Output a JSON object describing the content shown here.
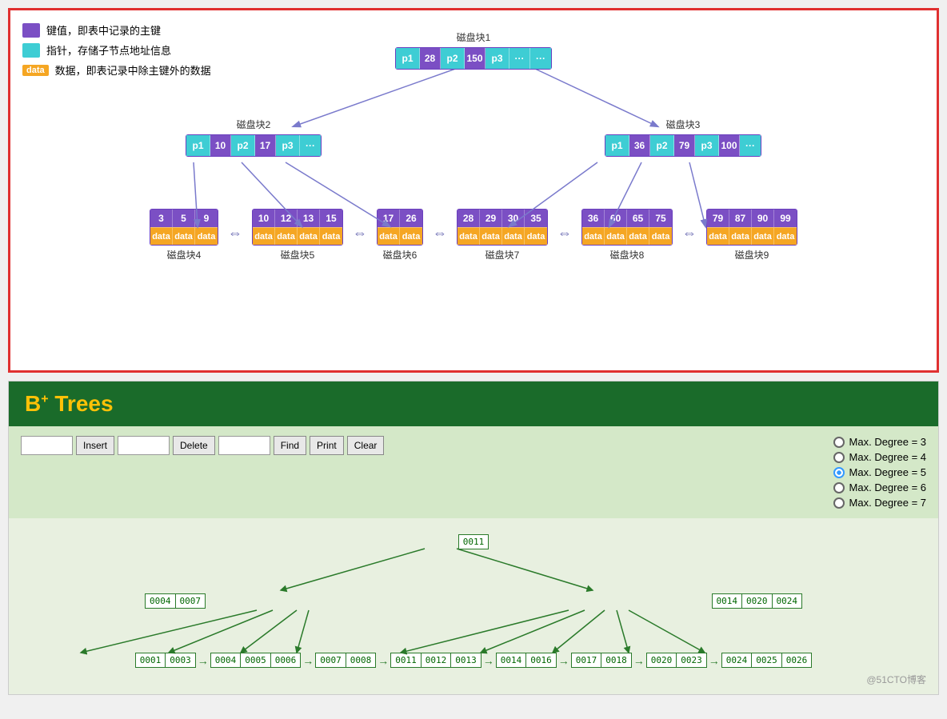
{
  "top": {
    "legend": [
      {
        "color": "purple",
        "text": "键值，即表中记录的主键"
      },
      {
        "color": "teal",
        "text": "指针，存储子节点地址信息"
      },
      {
        "color": "orange",
        "text": "数据，即表记录中除主键外的数据",
        "label": "data"
      }
    ],
    "disk1": {
      "label": "磁盘块1",
      "cells": [
        "p1",
        "28",
        "p2",
        "150",
        "p3",
        "...",
        "..."
      ]
    },
    "disk2": {
      "label": "磁盘块2",
      "cells": [
        "p1",
        "10",
        "p2",
        "17",
        "p3",
        "..."
      ]
    },
    "disk3": {
      "label": "磁盘块3",
      "cells": [
        "p1",
        "36",
        "p2",
        "79",
        "p3",
        "100",
        "..."
      ]
    },
    "leaves": [
      {
        "label": "磁盘块4",
        "keys": [
          "3",
          "5",
          "9"
        ]
      },
      {
        "label": "磁盘块5",
        "keys": [
          "10",
          "12",
          "13",
          "15"
        ]
      },
      {
        "label": "磁盘块6",
        "keys": [
          "17",
          "26"
        ]
      },
      {
        "label": "磁盘块7",
        "keys": [
          "28",
          "29",
          "30",
          "35"
        ]
      },
      {
        "label": "磁盘块8",
        "keys": [
          "36",
          "60",
          "65",
          "75"
        ]
      },
      {
        "label": "磁盘块9",
        "keys": [
          "79",
          "87",
          "90",
          "99"
        ]
      }
    ]
  },
  "bottom": {
    "title": "B",
    "title_sup": "+",
    "title_rest": " Trees",
    "controls": {
      "insert_label": "Insert",
      "delete_label": "Delete",
      "find_label": "Find",
      "print_label": "Print",
      "clear_label": "Clear",
      "insert_placeholder": "",
      "delete_placeholder": "",
      "find_placeholder": ""
    },
    "degrees": [
      {
        "label": "Max. Degree = 3",
        "selected": false
      },
      {
        "label": "Max. Degree = 4",
        "selected": false
      },
      {
        "label": "Max. Degree = 5",
        "selected": true
      },
      {
        "label": "Max. Degree = 6",
        "selected": false
      },
      {
        "label": "Max. Degree = 7",
        "selected": false
      }
    ],
    "tree": {
      "root": [
        "0011"
      ],
      "level2_left": [
        "0004",
        "0007"
      ],
      "level2_right": [
        "0014",
        "0020",
        "0024"
      ],
      "leaves": [
        "0001",
        "0003",
        "0004",
        "0005",
        "0006",
        "0007",
        "0008",
        "0011",
        "0012",
        "0013",
        "0014",
        "0016",
        "0017",
        "0018",
        "0020",
        "0023",
        "0024",
        "0025",
        "0026"
      ]
    },
    "watermark": "@51CTO博客"
  }
}
